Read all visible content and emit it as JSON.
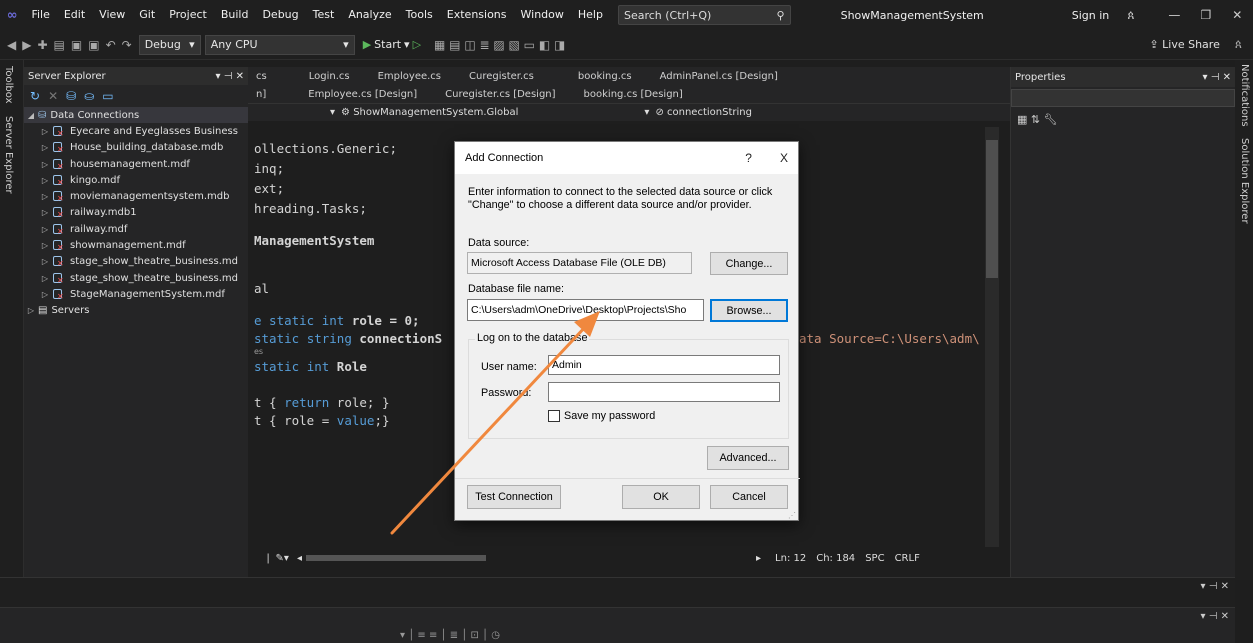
{
  "menubar": {
    "items": [
      "File",
      "Edit",
      "View",
      "Git",
      "Project",
      "Build",
      "Debug",
      "Test",
      "Analyze",
      "Tools",
      "Extensions",
      "Window",
      "Help"
    ],
    "search_placeholder": "Search (Ctrl+Q)",
    "solution_name": "ShowManagementSystem",
    "sign_in": "Sign in"
  },
  "toolbar": {
    "config": "Debug",
    "platform": "Any CPU",
    "start": "Start",
    "live_share": "Live Share"
  },
  "side_tabs": {
    "toolbox": "Toolbox",
    "server_explorer": "Server Explorer",
    "notifications": "Notifications",
    "solution_explorer": "Solution Explorer"
  },
  "server_explorer": {
    "title": "Server Explorer",
    "root": "Data Connections",
    "connections": [
      "Eyecare and Eyeglasses Business",
      "House_building_database.mdb",
      "housemanagement.mdf",
      "kingo.mdf",
      "moviemanagementsystem.mdb",
      "railway.mdb1",
      "railway.mdf",
      "showmanagement.mdf",
      "stage_show_theatre_business.md",
      "stage_show_theatre_business.md",
      "StageManagementSystem.mdf"
    ],
    "servers": "Servers"
  },
  "editor": {
    "tabs_row1": [
      "cs",
      "Login.cs",
      "Employee.cs",
      "Curegister.cs",
      "booking.cs",
      "AdminPanel.cs [Design]"
    ],
    "tabs_row2": [
      "n]",
      "Employee.cs [Design]",
      "Curegister.cs [Design]",
      "booking.cs [Design]"
    ],
    "nav_class": "ShowManagementSystem.Global",
    "nav_member": "connectionString",
    "code": {
      "l1": "ollections.Generic;",
      "l2": "inq;",
      "l3": "ext;",
      "l4": "hreading.Tasks;",
      "l5": "ManagementSystem",
      "l6": "al",
      "l7a": "e static ",
      "l7b": "int",
      "l7c": " role = 0;",
      "l8a": " static ",
      "l8b": "string",
      "l8c": " connectionS",
      "l8d": "ata Source=C:\\Users\\adm\\",
      "hint": "es",
      "l9a": " static ",
      "l9b": "int",
      "l9c": " Role",
      "l10a": "t { ",
      "l10b": "return",
      "l10c": " role; }",
      "l11a": "t { role = ",
      "l11b": "value",
      "l11c": ";}"
    },
    "status": {
      "ln": "Ln: 12",
      "ch": "Ch: 184",
      "spc": "SPC",
      "crlf": "CRLF"
    }
  },
  "properties": {
    "title": "Properties"
  },
  "dialog": {
    "title": "Add Connection",
    "help": "?",
    "close": "X",
    "description": "Enter information to connect to the selected data source or click \"Change\" to choose a different data source and/or provider.",
    "data_source_label": "Data source:",
    "data_source_value": "Microsoft Access Database File (OLE DB)",
    "change_button": "Change...",
    "db_file_label": "Database file name:",
    "db_file_value": "C:\\Users\\adm\\OneDrive\\Desktop\\Projects\\Sho",
    "browse_button": "Browse...",
    "logon_group": "Log on to the database",
    "username_label": "User name:",
    "username_value": "Admin",
    "password_label": "Password:",
    "password_value": "",
    "save_password_label": "Save my password",
    "advanced_button": "Advanced...",
    "test_button": "Test Connection",
    "ok_button": "OK",
    "cancel_button": "Cancel"
  },
  "colors": {
    "annotation_arrow": "#f0883e",
    "accent": "#0078d7"
  }
}
